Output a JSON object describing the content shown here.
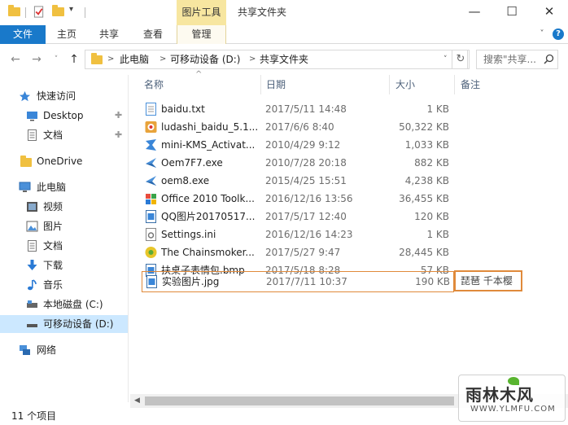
{
  "window": {
    "context_tab": "图片工具",
    "title": "共享文件夹",
    "minimize": "—",
    "maximize": "☐",
    "close": "✕"
  },
  "ribbon": {
    "tabs": [
      "文件",
      "主页",
      "共享",
      "查看",
      "管理"
    ],
    "collapse": "˅",
    "help": "?"
  },
  "address": {
    "crumbs": [
      "此电脑",
      "可移动设备 (D:)",
      "共享文件夹"
    ],
    "search_placeholder": "搜索\"共享...",
    "refresh": "↻"
  },
  "sidebar": {
    "items": [
      {
        "label": "快速访问",
        "icon": "star-icon"
      },
      {
        "label": "Desktop",
        "icon": "desktop-icon",
        "pinned": true
      },
      {
        "label": "文档",
        "icon": "document-icon",
        "pinned": true
      },
      {
        "label": "OneDrive",
        "icon": "onedrive-folder-icon"
      },
      {
        "label": "此电脑",
        "icon": "computer-icon"
      },
      {
        "label": "视频",
        "icon": "video-icon"
      },
      {
        "label": "图片",
        "icon": "picture-icon"
      },
      {
        "label": "文档",
        "icon": "document-icon"
      },
      {
        "label": "下载",
        "icon": "download-icon"
      },
      {
        "label": "音乐",
        "icon": "music-icon"
      },
      {
        "label": "本地磁盘 (C:)",
        "icon": "drive-icon"
      },
      {
        "label": "可移动设备 (D:)",
        "icon": "removable-drive-icon",
        "selected": true
      },
      {
        "label": "网络",
        "icon": "network-icon"
      }
    ]
  },
  "columns": {
    "name": "名称",
    "date": "日期",
    "size": "大小",
    "remark": "备注"
  },
  "files": [
    {
      "name": "baidu.txt",
      "date": "2017/5/11 14:48",
      "size": "1 KB",
      "icon": "text-file-icon"
    },
    {
      "name": "ludashi_baidu_5.1...",
      "date": "2017/6/6 8:40",
      "size": "50,322 KB",
      "icon": "installer-icon"
    },
    {
      "name": "mini-KMS_Activat...",
      "date": "2010/4/29 9:12",
      "size": "1,033 KB",
      "icon": "exe-icon"
    },
    {
      "name": "Oem7F7.exe",
      "date": "2010/7/28 20:18",
      "size": "882 KB",
      "icon": "exe-icon"
    },
    {
      "name": "oem8.exe",
      "date": "2015/4/25 15:51",
      "size": "4,238 KB",
      "icon": "exe-icon"
    },
    {
      "name": "Office 2010 Toolk...",
      "date": "2016/12/16 13:56",
      "size": "36,455 KB",
      "icon": "office-icon"
    },
    {
      "name": "QQ图片20170517...",
      "date": "2017/5/17 12:40",
      "size": "120 KB",
      "icon": "image-file-icon"
    },
    {
      "name": "Settings.ini",
      "date": "2016/12/16 14:23",
      "size": "1 KB",
      "icon": "ini-file-icon"
    },
    {
      "name": "The Chainsmoker...",
      "date": "2017/5/27 9:47",
      "size": "28,445 KB",
      "icon": "media-file-icon"
    },
    {
      "name": "扶桌子表情包.bmp",
      "date": "2017/5/18 8:28",
      "size": "57 KB",
      "icon": "image-file-icon"
    },
    {
      "name": "实验图片.jpg",
      "date": "2017/7/11 10:37",
      "size": "190 KB",
      "icon": "image-file-icon",
      "selected": true,
      "remark": "琵琶 千本樱"
    }
  ],
  "status": {
    "item_count": "11 个项目"
  },
  "watermark": {
    "main": "雨林木风",
    "sub": "WWW.YLMFU.COM"
  }
}
